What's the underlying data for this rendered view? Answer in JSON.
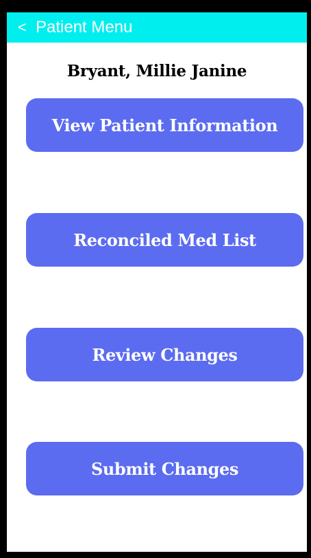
{
  "colors": {
    "header_bg": "#00eeee",
    "button_bg": "#5b6cf0",
    "frame": "#000000"
  },
  "header": {
    "back_icon": "<",
    "back_icon_name": "chevron-left-icon",
    "title": "Patient Menu"
  },
  "patient": {
    "name": "Bryant, Millie Janine"
  },
  "menu": {
    "items": [
      {
        "label": "View Patient Information"
      },
      {
        "label": "Reconciled Med List"
      },
      {
        "label": "Review Changes"
      },
      {
        "label": "Submit Changes"
      }
    ]
  }
}
